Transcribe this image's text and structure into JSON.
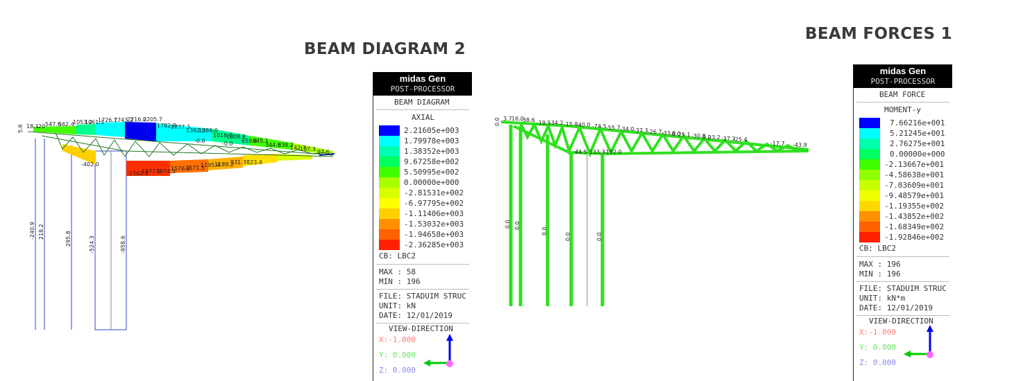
{
  "titles": {
    "left": "BEAM DIAGRAM 2",
    "right": "BEAM FORCES 1"
  },
  "left_panel": {
    "brand": "midas Gen",
    "subtitle": "POST-PROCESSOR",
    "type": "BEAM DIAGRAM",
    "component": "AXIAL",
    "legend": [
      {
        "value": "2.21605e+003",
        "color": "#0000ff"
      },
      {
        "value": "1.79978e+003",
        "color": "#00ffff"
      },
      {
        "value": "1.38352e+003",
        "color": "#00ffb0"
      },
      {
        "value": "9.67258e+002",
        "color": "#00ff60"
      },
      {
        "value": "5.50995e+002",
        "color": "#40ff00"
      },
      {
        "value": "0.00000e+000",
        "color": "#a8ff00"
      },
      {
        "value": "-2.81531e+002",
        "color": "#d8ff00"
      },
      {
        "value": "-6.97795e+002",
        "color": "#ffff00"
      },
      {
        "value": "-1.11406e+003",
        "color": "#ffd000"
      },
      {
        "value": "-1.53032e+003",
        "color": "#ff9000"
      },
      {
        "value": "-1.94658e+003",
        "color": "#ff6000"
      },
      {
        "value": "-2.36285e+003",
        "color": "#ff2000"
      }
    ],
    "cb": "CB: LBC2",
    "max": "MAX : 58",
    "min": "MIN : 196",
    "file": "FILE: STADUIM STRUC",
    "unit": "UNIT: kN",
    "date": "DATE: 12/01/2019",
    "view": "VIEW-DIRECTION",
    "x": "X:-1.000",
    "y": "Y: 0.000",
    "z": "Z: 0.000"
  },
  "right_panel": {
    "brand": "midas Gen",
    "subtitle": "POST-PROCESSOR",
    "type": "BEAM FORCE",
    "component": "MOMENT-y",
    "legend": [
      {
        "value": "7.66216e+001",
        "color": "#0000ff"
      },
      {
        "value": "5.21245e+001",
        "color": "#00ffff"
      },
      {
        "value": "2.76275e+001",
        "color": "#00ffb0"
      },
      {
        "value": "0.00000e+000",
        "color": "#00ff60"
      },
      {
        "value": "-2.13667e+001",
        "color": "#40ff00"
      },
      {
        "value": "-4.58638e+001",
        "color": "#90ff00"
      },
      {
        "value": "-7.03609e+001",
        "color": "#c8ff00"
      },
      {
        "value": "-9.48579e+001",
        "color": "#f0ff00"
      },
      {
        "value": "-1.19355e+002",
        "color": "#ffd800"
      },
      {
        "value": "-1.43852e+002",
        "color": "#ff9000"
      },
      {
        "value": "-1.68349e+002",
        "color": "#ff6000"
      },
      {
        "value": "-1.92846e+002",
        "color": "#ff2000"
      }
    ],
    "cb": "CB: LBC2",
    "max": "MAX : 196",
    "min": "MIN : 196",
    "file": "FILE: STADUIM STRUC",
    "unit": "UNIT: kN*m",
    "date": "DATE: 12/01/2019",
    "view": "VIEW-DIRECTION",
    "x": "X:-1.000",
    "y": "Y: 0.000",
    "z": "Z: 0.000"
  },
  "axial_diagram": {
    "column_labels": [
      "-240.9",
      "218.2",
      "295.8",
      "-524.3",
      "-958.6"
    ],
    "top_labels": [
      "5.6",
      "18.1",
      "-20",
      "547.6",
      "562.4",
      "1053.2",
      "1061.3",
      "1726.7",
      "1743.2",
      "2216.0",
      "2205.7",
      "1782.8",
      "1777.3",
      "1392.0",
      "1386.0",
      "1016.0",
      "1008.8",
      "659.6",
      "645.1",
      "344.6",
      "338.3",
      "142.7",
      "197.3",
      "97.6",
      "-0.0",
      "-0.0"
    ],
    "bottom_labels": [
      "-402.0",
      "-2362.9",
      "1977.9",
      "1974.3",
      "1576.9",
      "1571.5",
      "1195.4",
      "1189.2",
      "831.7",
      "-823.4"
    ]
  },
  "moment_diagram": {
    "column_labels": [
      "0.0",
      "0.0",
      "0.0",
      "0.0",
      "0.0"
    ],
    "top_labels": [
      "0.0",
      "3.7",
      "16.0",
      "-38.6",
      "-19.5",
      "-34.2",
      "-15.8",
      "-40.0",
      "-74.5",
      "-55.7",
      "-34.0",
      "-37.3",
      "-26.7",
      "-33.6",
      "0.0",
      "25.1",
      "-30.8",
      "0.0",
      "23.2",
      "-27.3",
      "-25.4",
      "-17.7",
      "-43.9"
    ],
    "bottom_labels": [
      "44.5",
      "133.3",
      "-192.0"
    ]
  }
}
